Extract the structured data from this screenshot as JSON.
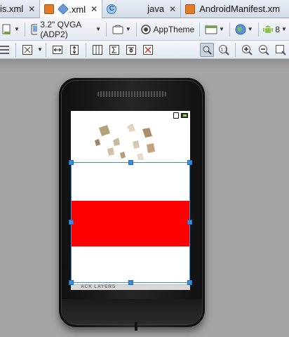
{
  "tabs": [
    {
      "label": "is.xml",
      "icon": "xml-file-icon",
      "active": false
    },
    {
      "label": ".xml",
      "icon": "layout-file-icon",
      "active": true
    },
    {
      "label": "java",
      "icon": "java-class-icon",
      "active": false
    },
    {
      "label": "AndroidManifest.xm",
      "icon": "manifest-file-icon",
      "active": false
    }
  ],
  "toolbar": {
    "device": "3.2\" QVGA (ADP2)",
    "theme": "AppTheme",
    "api_level": "8"
  },
  "phone": {
    "bottom_label": "ACK LAYERS"
  },
  "colors": {
    "selection": "#3a8fdc",
    "red_band": "#ff0000",
    "canvas": "#a3a3a3"
  }
}
